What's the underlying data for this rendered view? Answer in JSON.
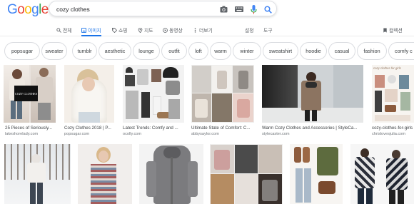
{
  "logo": {
    "letters": [
      "G",
      "o",
      "o",
      "g",
      "l",
      "e"
    ],
    "colors": [
      "#4285f4",
      "#ea4335",
      "#fbbc05",
      "#4285f4",
      "#34a853",
      "#ea4335"
    ]
  },
  "search": {
    "query": "cozy clothes"
  },
  "tabs": [
    {
      "label": "전체",
      "icon": "search-icon"
    },
    {
      "label": "이미지",
      "icon": "image-icon",
      "active": true
    },
    {
      "label": "쇼핑",
      "icon": "tag-icon"
    },
    {
      "label": "지도",
      "icon": "map-pin-icon"
    },
    {
      "label": "동영상",
      "icon": "play-icon"
    },
    {
      "label": "더보기",
      "icon": "more-icon"
    }
  ],
  "tools": {
    "settings": "설정",
    "tools": "도구",
    "collection": "컬렉션"
  },
  "chips": [
    "popsugar",
    "sweater",
    "tumblr",
    "aesthetic",
    "lounge",
    "outfit",
    "loft",
    "warm",
    "winter",
    "sweatshirt",
    "hoodie",
    "casual",
    "fashion",
    "comfy c"
  ],
  "results": [
    {
      "caption": "25 Pieces of Seriously...",
      "site": "lakeshorelady.com"
    },
    {
      "caption": "Cozy Clothes 2018 | P...",
      "site": "popsugar.com"
    },
    {
      "caption": "Latest Trends: Comfy and ...",
      "site": "ocolly.com"
    },
    {
      "caption": "Ultimate State of Comfort: C...",
      "site": "abbysaylor.com"
    },
    {
      "caption": "Warm Cozy Clothes and Accessories | StyleCa...",
      "site": "stylecaster.com"
    },
    {
      "caption": "cozy-clothes-for-girls",
      "site": "chrislovesjulia.com"
    }
  ],
  "thumb_texts": {
    "cozy_clothes_card": "COZY CLOTHES",
    "cozy_girls_banner": "cozy clothes for girls"
  },
  "colors": {
    "accent": "#1a73e8",
    "text": "#202124",
    "muted": "#70757a",
    "border": "#dadce0"
  }
}
